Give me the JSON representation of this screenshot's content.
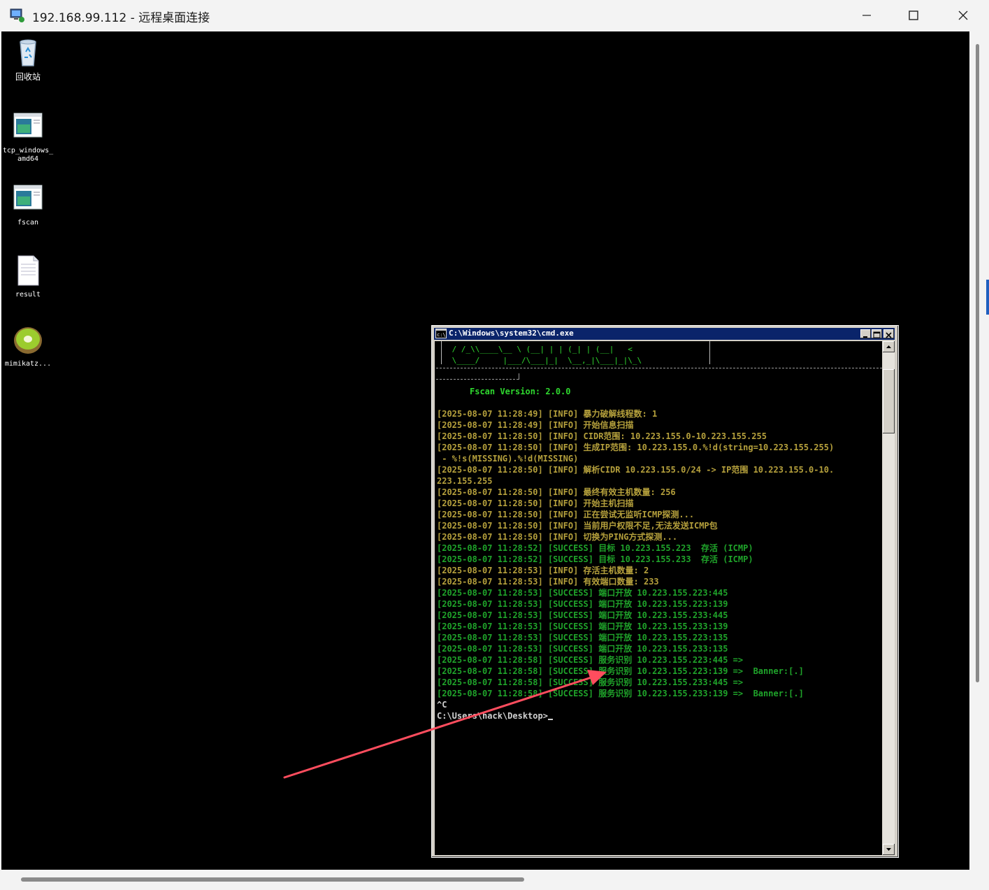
{
  "window": {
    "title": "192.168.99.112 - 远程桌面连接"
  },
  "desktop": {
    "icons": [
      {
        "label": "回收站",
        "icon": "recycle-bin-icon"
      },
      {
        "label": "tcp_windows_amd64",
        "icon": "exe-window-icon"
      },
      {
        "label": "fscan",
        "icon": "exe-window-icon"
      },
      {
        "label": "result",
        "icon": "text-file-icon"
      },
      {
        "label": "mimikatz...",
        "icon": "kiwi-icon"
      }
    ]
  },
  "cmd": {
    "title": "C:\\Windows\\system32\\cmd.exe",
    "art": [
      " / /_\\\\____\\__ \\ (__| | | (_| | (__|   <",
      " \\____/     |___/\\___|_|  \\__,_|\\___|_|\\_\\",
      "─────────────────────────────────────────────────────────────────────────────────",
      "───────────────┘"
    ],
    "version": "Fscan Version: 2.0.0",
    "lines": [
      {
        "text": "[2025-08-07 11:28:49] [INFO] 暴力破解线程数: 1",
        "kind": "info"
      },
      {
        "text": "[2025-08-07 11:28:49] [INFO] 开始信息扫描",
        "kind": "info"
      },
      {
        "text": "[2025-08-07 11:28:50] [INFO] CIDR范围: 10.223.155.0-10.223.155.255",
        "kind": "info"
      },
      {
        "text": "[2025-08-07 11:28:50] [INFO] 生成IP范围: 10.223.155.0.%!d(string=10.223.155.255)",
        "kind": "info"
      },
      {
        "text": " - %!s(MISSING).%!d(MISSING)",
        "kind": "info"
      },
      {
        "text": "[2025-08-07 11:28:50] [INFO] 解析CIDR 10.223.155.0/24 -> IP范围 10.223.155.0-10.",
        "kind": "info"
      },
      {
        "text": "223.155.255",
        "kind": "info"
      },
      {
        "text": "[2025-08-07 11:28:50] [INFO] 最终有效主机数量: 256",
        "kind": "info"
      },
      {
        "text": "[2025-08-07 11:28:50] [INFO] 开始主机扫描",
        "kind": "info"
      },
      {
        "text": "[2025-08-07 11:28:50] [INFO] 正在尝试无监听ICMP探测...",
        "kind": "info"
      },
      {
        "text": "[2025-08-07 11:28:50] [INFO] 当前用户权限不足,无法发送ICMP包",
        "kind": "info"
      },
      {
        "text": "[2025-08-07 11:28:50] [INFO] 切换为PING方式探测...",
        "kind": "info"
      },
      {
        "text": "[2025-08-07 11:28:52] [SUCCESS] 目标 10.223.155.223  存活 (ICMP)",
        "kind": "succ"
      },
      {
        "text": "[2025-08-07 11:28:52] [SUCCESS] 目标 10.223.155.233  存活 (ICMP)",
        "kind": "succ"
      },
      {
        "text": "[2025-08-07 11:28:53] [INFO] 存活主机数量: 2",
        "kind": "info"
      },
      {
        "text": "[2025-08-07 11:28:53] [INFO] 有效端口数量: 233",
        "kind": "info"
      },
      {
        "text": "[2025-08-07 11:28:53] [SUCCESS] 端口开放 10.223.155.223:445",
        "kind": "succ"
      },
      {
        "text": "[2025-08-07 11:28:53] [SUCCESS] 端口开放 10.223.155.223:139",
        "kind": "succ"
      },
      {
        "text": "[2025-08-07 11:28:53] [SUCCESS] 端口开放 10.223.155.233:445",
        "kind": "succ"
      },
      {
        "text": "[2025-08-07 11:28:53] [SUCCESS] 端口开放 10.223.155.233:139",
        "kind": "succ"
      },
      {
        "text": "[2025-08-07 11:28:53] [SUCCESS] 端口开放 10.223.155.223:135",
        "kind": "succ"
      },
      {
        "text": "[2025-08-07 11:28:53] [SUCCESS] 端口开放 10.223.155.233:135",
        "kind": "succ"
      },
      {
        "text": "[2025-08-07 11:28:58] [SUCCESS] 服务识别 10.223.155.223:445 =>",
        "kind": "succ"
      },
      {
        "text": "[2025-08-07 11:28:58] [SUCCESS] 服务识别 10.223.155.223:139 =>  Banner:[.]",
        "kind": "succ"
      },
      {
        "text": "[2025-08-07 11:28:58] [SUCCESS] 服务识别 10.223.155.233:445 =>",
        "kind": "succ"
      },
      {
        "text": "[2025-08-07 11:28:58] [SUCCESS] 服务识别 10.223.155.233:139 =>  Banner:[.]",
        "kind": "succ"
      },
      {
        "text": "^C",
        "kind": "white"
      },
      {
        "text": "C:\\Users\\hack\\Desktop>",
        "kind": "white"
      }
    ]
  },
  "colors": {
    "info": "#b5a03c",
    "success": "#1fa32a",
    "annotation_arrow": "#ff4d5e"
  }
}
